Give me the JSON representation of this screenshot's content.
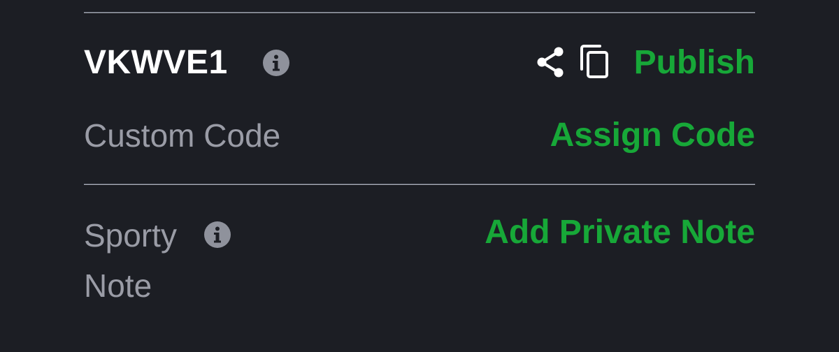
{
  "booking": {
    "code": "VKWVE1",
    "info_icon": "info-icon",
    "share_icon": "share-icon",
    "copy_icon": "copy-icon",
    "publish_label": "Publish"
  },
  "custom_code": {
    "label": "Custom Code",
    "action_label": "Assign Code"
  },
  "sporty_note": {
    "label_line1": "Sporty",
    "label_line2": "Note",
    "info_icon": "info-icon",
    "action_label": "Add Private Note"
  },
  "colors": {
    "background": "#1c1e24",
    "accent_green": "#17a838",
    "muted_text": "#9a9ca6",
    "primary_text": "#ffffff",
    "icon_gray": "#8f929c"
  }
}
